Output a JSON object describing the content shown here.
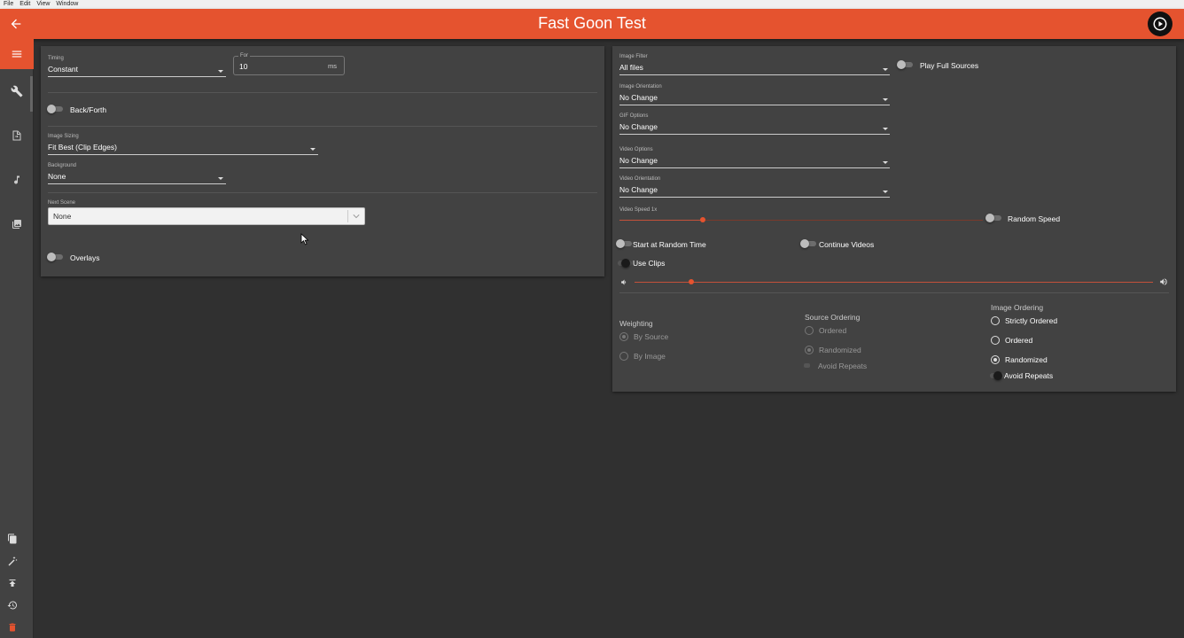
{
  "menubar": {
    "items": [
      "File",
      "Edit",
      "View",
      "Window"
    ]
  },
  "header": {
    "title": "Fast Goon Test"
  },
  "left_panel": {
    "timing": {
      "label": "Timing",
      "value": "Constant"
    },
    "for": {
      "label": "For",
      "value": "10",
      "unit": "ms"
    },
    "back_forth": {
      "label": "Back/Forth"
    },
    "image_sizing": {
      "label": "Image Sizing",
      "value": "Fit Best (Clip Edges)"
    },
    "background": {
      "label": "Background",
      "value": "None"
    },
    "next_scene": {
      "label": "Next Scene",
      "value": "None"
    },
    "overlays": {
      "label": "Overlays"
    }
  },
  "right_panel": {
    "image_filter": {
      "label": "Image Filter",
      "value": "All files"
    },
    "play_full_sources": {
      "label": "Play Full Sources"
    },
    "image_orientation": {
      "label": "Image Orientation",
      "value": "No Change"
    },
    "gif_options": {
      "label": "GIF Options",
      "value": "No Change"
    },
    "video_options": {
      "label": "Video Options",
      "value": "No Change"
    },
    "video_orientation": {
      "label": "Video Orientation",
      "value": "No Change"
    },
    "video_speed": {
      "label": "Video Speed 1x",
      "fraction": 0.23
    },
    "random_speed": {
      "label": "Random Speed"
    },
    "start_random_time": {
      "label": "Start at Random Time"
    },
    "continue_videos": {
      "label": "Continue Videos"
    },
    "use_clips": {
      "label": "Use Clips"
    },
    "volume": {
      "fraction": 0.11
    },
    "weighting": {
      "title": "Weighting",
      "options": [
        "By Source",
        "By Image"
      ]
    },
    "source_ordering": {
      "title": "Source Ordering",
      "options": [
        "Ordered",
        "Randomized"
      ],
      "avoid_repeats": "Avoid Repeats"
    },
    "image_ordering": {
      "title": "Image Ordering",
      "options": [
        "Strictly Ordered",
        "Ordered",
        "Randomized"
      ],
      "avoid_repeats": "Avoid Repeats"
    }
  },
  "colors": {
    "accent": "#e5532f",
    "background": "#303030",
    "card": "#424242"
  }
}
